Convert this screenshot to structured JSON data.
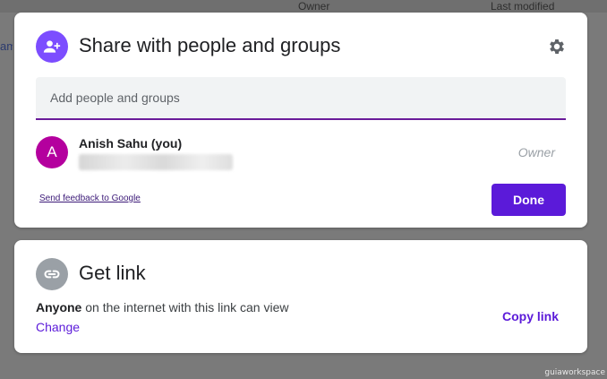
{
  "background": {
    "owner_col": "Owner",
    "modified_col": "Last modified",
    "left_text": "am"
  },
  "share_dialog": {
    "title": "Share with people and groups",
    "add_placeholder": "Add people and groups",
    "person": {
      "initial": "A",
      "name": "Anish Sahu (you)",
      "role": "Owner"
    },
    "feedback_label": "Send feedback to Google",
    "done_label": "Done"
  },
  "get_link": {
    "title": "Get link",
    "desc_bold": "Anyone",
    "desc_rest": " on the internet with this link can view",
    "change_label": "Change",
    "copy_label": "Copy link"
  },
  "watermark": "guiaworkspace",
  "colors": {
    "accent": "#5b1ad9",
    "person_avatar": "#b4009e",
    "share_icon_bg": "#7c4dff",
    "field_underline": "#6a1b9a"
  }
}
